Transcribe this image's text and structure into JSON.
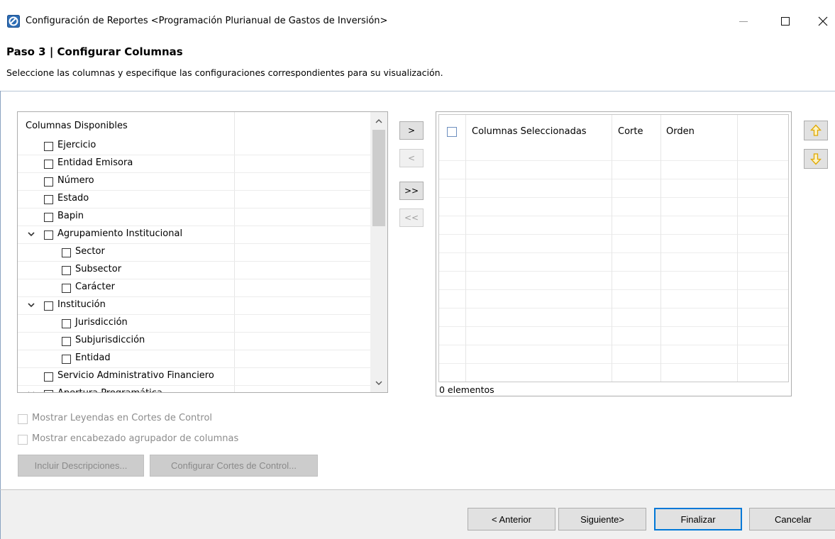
{
  "window": {
    "title": "Configuración de Reportes <Programación Plurianual de Gastos de Inversión>"
  },
  "step": {
    "title": "Paso 3 | Configurar Columnas",
    "description": "Seleccione las columnas y especifique las configuraciones correspondientes para su visualización."
  },
  "available": {
    "header": "Columnas Disponibles",
    "items": [
      {
        "label": "Ejercicio",
        "level": 0,
        "expandable": false
      },
      {
        "label": "Entidad Emisora",
        "level": 0,
        "expandable": false
      },
      {
        "label": "Número",
        "level": 0,
        "expandable": false
      },
      {
        "label": "Estado",
        "level": 0,
        "expandable": false
      },
      {
        "label": "Bapin",
        "level": 0,
        "expandable": false
      },
      {
        "label": "Agrupamiento Institucional",
        "level": 0,
        "expandable": true
      },
      {
        "label": "Sector",
        "level": 1,
        "expandable": false
      },
      {
        "label": "Subsector",
        "level": 1,
        "expandable": false
      },
      {
        "label": "Carácter",
        "level": 1,
        "expandable": false
      },
      {
        "label": "Institución",
        "level": 0,
        "expandable": true
      },
      {
        "label": "Jurisdicción",
        "level": 1,
        "expandable": false
      },
      {
        "label": "Subjurisdicción",
        "level": 1,
        "expandable": false
      },
      {
        "label": "Entidad",
        "level": 1,
        "expandable": false
      },
      {
        "label": "Servicio Administrativo Financiero",
        "level": 0,
        "expandable": false
      },
      {
        "label": "Apertura Programática",
        "level": 0,
        "expandable": true
      }
    ]
  },
  "transfer": {
    "add": ">",
    "remove": "<",
    "add_all": ">>",
    "remove_all": "<<"
  },
  "selected": {
    "columns": [
      "Columnas Seleccionadas",
      "Corte",
      "Orden"
    ],
    "count_label": "0 elementos"
  },
  "options": {
    "show_legends": "Mostrar Leyendas en Cortes de Control",
    "show_group_header": "Mostrar encabezado agrupador de columnas"
  },
  "buttons": {
    "include_descriptions": "Incluir Descripciones...",
    "configure_cuts": "Configurar Cortes de Control...",
    "back": "< Anterior",
    "next": "Siguiente>",
    "finish": "Finalizar",
    "cancel": "Cancelar"
  },
  "icons": {
    "app": "report-app-icon",
    "move_up": "arrow-up-icon",
    "move_down": "arrow-down-icon"
  },
  "colors": {
    "accent": "#0078d7",
    "move_arrow": "#f5b800"
  }
}
